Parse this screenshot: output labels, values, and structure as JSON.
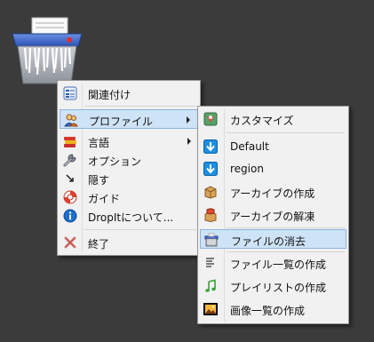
{
  "menu": {
    "items": [
      {
        "label": "関連付け"
      },
      {
        "label": "プロファイル"
      },
      {
        "label": "言語"
      },
      {
        "label": "オプション"
      },
      {
        "label": "隠す"
      },
      {
        "label": "ガイド"
      },
      {
        "label": "DropItについて..."
      },
      {
        "label": "終了"
      }
    ]
  },
  "submenu": {
    "items": [
      {
        "label": "カスタマイズ"
      },
      {
        "label": "Default"
      },
      {
        "label": "region"
      },
      {
        "label": "アーカイブの作成"
      },
      {
        "label": "アーカイブの解凍"
      },
      {
        "label": "ファイルの消去"
      },
      {
        "label": "ファイル一覧の作成"
      },
      {
        "label": "プレイリストの作成"
      },
      {
        "label": "画像一覧の作成"
      }
    ]
  },
  "colors": {
    "background": "#3b3b3b",
    "menu_bg": "#f1f1f1",
    "highlight": "#cfe3f7",
    "highlight_border": "#8cb4df",
    "download_blue": "#1c8fe0"
  }
}
